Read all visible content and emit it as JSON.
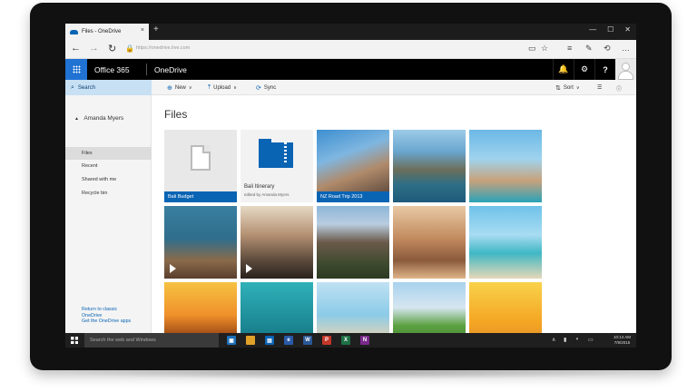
{
  "browser": {
    "tab_title": "Files - OneDrive",
    "tab_close": "×",
    "new_tab": "+",
    "minimize": "—",
    "maximize": "☐",
    "close": "✕",
    "url": "https://onedrive.live.com"
  },
  "header": {
    "brand": "Office 365",
    "app": "OneDrive",
    "bell": "🔔",
    "gear": "⚙",
    "help": "?"
  },
  "commands": {
    "search": "Search",
    "new": "New",
    "upload": "Upload",
    "sync": "Sync",
    "sort": "Sort",
    "caret": "∨"
  },
  "nav": {
    "user": "Amanda Myers",
    "items": [
      "Files",
      "Recent",
      "Shared with me",
      "Recycle bin"
    ],
    "get_apps": "Get the OneDrive apps",
    "return_line1": "Return to classic",
    "return_line2": "OneDrive"
  },
  "main": {
    "title": "Files",
    "tiles": [
      {
        "label": "Bali Budget"
      },
      {
        "label": "Bali Itinerary",
        "sub": "edited by Amanda Myers"
      },
      {
        "label": "NZ Road Trip 2013"
      }
    ]
  },
  "taskbar": {
    "search_placeholder": "Search the web and Windows",
    "time": "10:14 AM",
    "date": "7/9/2015",
    "apps": [
      "e",
      "W",
      "P",
      "X",
      "N"
    ]
  },
  "colors": {
    "accent": "#0a64b4",
    "waffle": "#2072d3",
    "header": "#000000",
    "search_bg": "#c7e0f4"
  }
}
